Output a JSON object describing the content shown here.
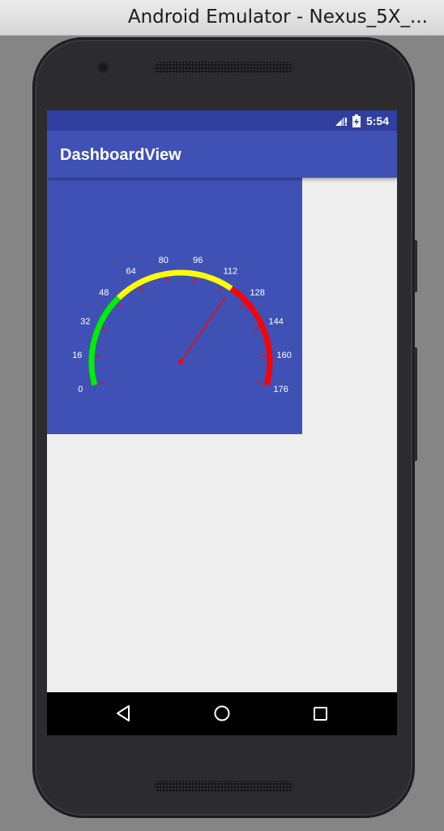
{
  "window": {
    "title": "Android Emulator - Nexus_5X_..."
  },
  "status_bar": {
    "time": "5:54",
    "icons": [
      "signal-icon",
      "battery-charging-icon"
    ]
  },
  "app_bar": {
    "title": "DashboardView"
  },
  "gauge": {
    "min": 0,
    "max": 176,
    "tick_labels": [
      "0",
      "16",
      "32",
      "48",
      "64",
      "80",
      "96",
      "112",
      "128",
      "144",
      "160",
      "176"
    ],
    "needle_value": 117,
    "bands": [
      {
        "from": 0,
        "to": 51,
        "color": "#00ee00"
      },
      {
        "from": 51,
        "to": 117,
        "color": "#ffff00"
      },
      {
        "from": 117,
        "to": 176,
        "color": "#ff0000"
      }
    ],
    "background": "#3f51b5",
    "needle_color": "#ff0000"
  },
  "nav_bar": {
    "buttons": [
      "back-icon",
      "home-icon",
      "recents-icon"
    ]
  },
  "colors": {
    "status_bar": "#303f9f",
    "primary": "#3f51b5",
    "screen_background": "#eeeeee"
  }
}
